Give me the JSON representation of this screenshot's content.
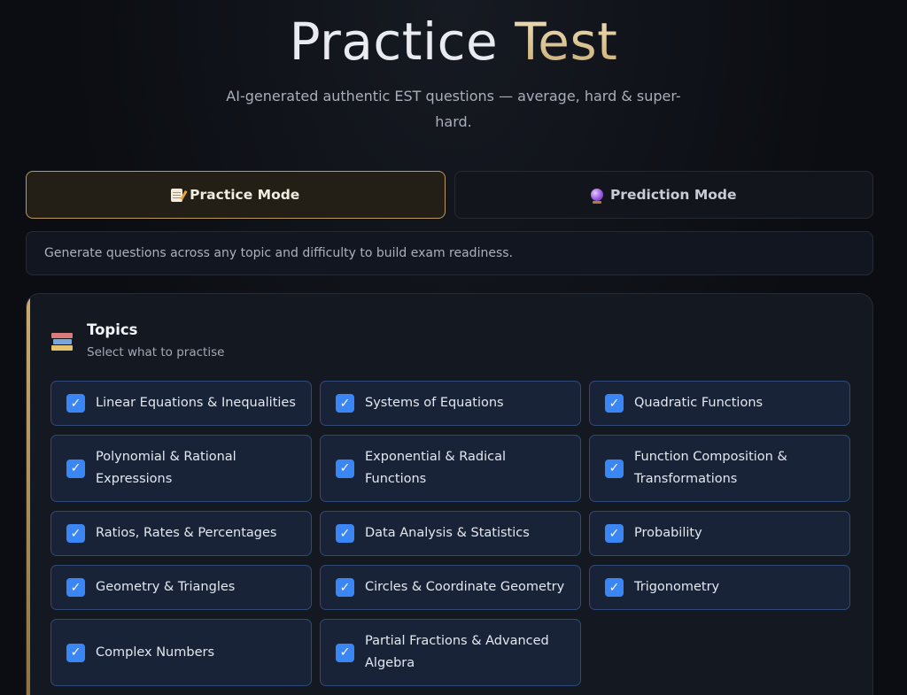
{
  "header": {
    "title_part1": "Practice",
    "title_part2": "Test",
    "subtitle": "AI-generated authentic EST questions — average, hard & super-hard."
  },
  "modes": [
    {
      "label": "Practice Mode",
      "icon": "memo-icon",
      "active": true
    },
    {
      "label": "Prediction Mode",
      "icon": "crystal-ball-icon",
      "active": false
    }
  ],
  "info": {
    "text": "Generate questions across any topic and difficulty to build exam readiness."
  },
  "topics_section": {
    "icon": "books-icon",
    "title": "Topics",
    "subtitle": "Select what to practise",
    "check_glyph": "✓",
    "items": [
      {
        "label": "Linear Equations & Inequalities",
        "checked": true
      },
      {
        "label": "Systems of Equations",
        "checked": true
      },
      {
        "label": "Quadratic Functions",
        "checked": true
      },
      {
        "label": "Polynomial & Rational Expressions",
        "checked": true
      },
      {
        "label": "Exponential & Radical Functions",
        "checked": true
      },
      {
        "label": "Function Composition & Transformations",
        "checked": true
      },
      {
        "label": "Ratios, Rates & Percentages",
        "checked": true
      },
      {
        "label": "Data Analysis & Statistics",
        "checked": true
      },
      {
        "label": "Probability",
        "checked": true
      },
      {
        "label": "Geometry & Triangles",
        "checked": true
      },
      {
        "label": "Circles & Coordinate Geometry",
        "checked": true
      },
      {
        "label": "Trigonometry",
        "checked": true
      },
      {
        "label": "Complex Numbers",
        "checked": true
      },
      {
        "label": "Partial Fractions & Advanced Algebra",
        "checked": true
      }
    ]
  },
  "colors": {
    "accent_gold": "#c9ac72",
    "checkbox_blue": "#3a86f4",
    "topic_bg": "#192338",
    "topic_border": "#2f4a78"
  }
}
